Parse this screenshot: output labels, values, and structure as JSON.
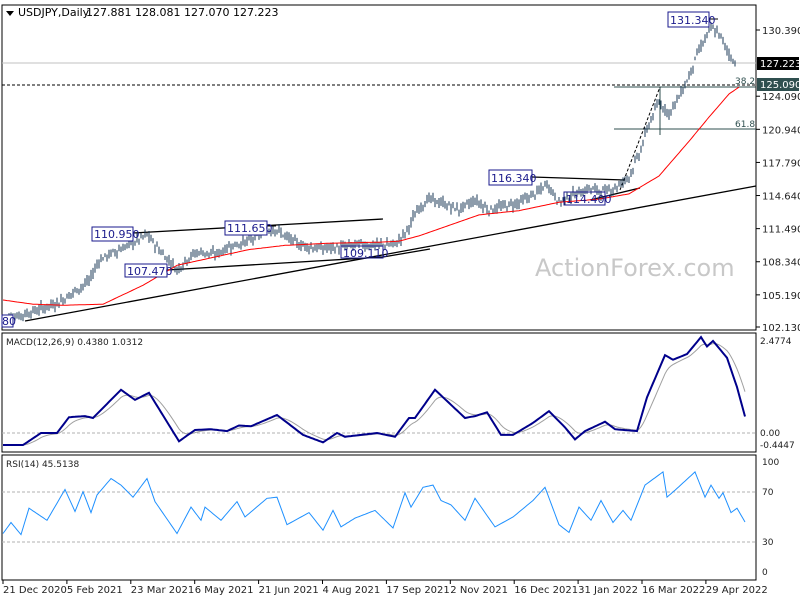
{
  "header": {
    "arrow_icon": "triangle-down-icon",
    "title": "USDJPY,Daily",
    "ohlc": "127.881 128.081 127.070 127.223"
  },
  "price_axis": [
    "130.390",
    "124.090",
    "120.940",
    "117.790",
    "114.640",
    "111.490",
    "108.340",
    "105.190",
    "102.130"
  ],
  "price_axis_values": [
    130.39,
    124.09,
    120.94,
    117.79,
    114.64,
    111.49,
    108.34,
    105.19,
    102.13
  ],
  "current_price": "127.223",
  "level_price": "125.090",
  "fib": {
    "f382": "38.2",
    "f618": "61.8"
  },
  "annotations": {
    "a131340": "131.340",
    "a116340": "116.340",
    "a114400": "114.400",
    "a110950": "110.950",
    "a111650": "111.650",
    "a107470": "107.470",
    "a109110": "109.110",
    "a_left": "80"
  },
  "watermark": "ActionForex.com",
  "macd": {
    "label": "MACD(12,26,9) 0.4380 1.0312",
    "axis": [
      "2.4774",
      "0.00",
      "-0.4447"
    ]
  },
  "rsi": {
    "label": "RSI(14) 45.5138",
    "axis": [
      "100",
      "70",
      "30",
      "0"
    ]
  },
  "dates": [
    "21 Dec 2020",
    "5 Feb 2021",
    "23 Mar 2021",
    "6 May 2021",
    "21 Jun 2021",
    "4 Aug 2021",
    "17 Sep 2021",
    "2 Nov 2021",
    "16 Dec 2021",
    "31 Jan 2022",
    "16 Mar 2022",
    "29 Apr 2022"
  ],
  "colors": {
    "bars": "#1b3a57",
    "ma": "#ff0000",
    "macd": "#00008b",
    "signal": "#a0a0a0",
    "rsi": "#1e90ff",
    "label": "#1a1a8c"
  },
  "chart_data": {
    "type": "line",
    "title": "USDJPY,Daily",
    "price_close": [
      [
        0,
        103.0
      ],
      [
        8,
        103.2
      ],
      [
        18,
        103.8
      ],
      [
        28,
        104.5
      ],
      [
        32,
        105.0
      ],
      [
        43,
        106.5
      ],
      [
        48,
        108.5
      ],
      [
        53,
        109.0
      ],
      [
        58,
        109.5
      ],
      [
        64,
        110.0
      ],
      [
        72,
        110.9
      ],
      [
        78,
        109.5
      ],
      [
        87,
        107.6
      ],
      [
        93,
        108.8
      ],
      [
        98,
        109.3
      ],
      [
        106,
        109.0
      ],
      [
        113,
        109.8
      ],
      [
        123,
        110.3
      ],
      [
        131,
        111.3
      ],
      [
        136,
        111.5
      ],
      [
        143,
        110.5
      ],
      [
        148,
        110.0
      ],
      [
        158,
        109.6
      ],
      [
        168,
        109.7
      ],
      [
        178,
        110.0
      ],
      [
        188,
        109.9
      ],
      [
        196,
        110.0
      ],
      [
        201,
        111.0
      ],
      [
        208,
        113.5
      ],
      [
        213,
        114.3
      ],
      [
        218,
        114.0
      ],
      [
        228,
        113.3
      ],
      [
        236,
        114.2
      ],
      [
        243,
        113.3
      ],
      [
        248,
        113.5
      ],
      [
        258,
        114.0
      ],
      [
        268,
        115.0
      ],
      [
        272,
        115.8
      ],
      [
        278,
        114.0
      ],
      [
        286,
        114.8
      ],
      [
        293,
        115.3
      ],
      [
        301,
        115.0
      ],
      [
        308,
        115.6
      ],
      [
        313,
        116.5
      ],
      [
        318,
        118.5
      ],
      [
        323,
        121.5
      ],
      [
        328,
        123.5
      ],
      [
        333,
        122.5
      ],
      [
        338,
        124.0
      ],
      [
        343,
        126.0
      ],
      [
        348,
        128.5
      ],
      [
        351,
        129.5
      ],
      [
        354,
        130.6
      ],
      [
        358,
        130.0
      ],
      [
        362,
        128.5
      ],
      [
        366,
        127.2
      ]
    ],
    "moving_average": [
      [
        0,
        104.7
      ],
      [
        15,
        104.3
      ],
      [
        30,
        104.2
      ],
      [
        50,
        104.3
      ],
      [
        70,
        106.1
      ],
      [
        87,
        108.0
      ],
      [
        123,
        109.5
      ],
      [
        141,
        109.9
      ],
      [
        163,
        110.1
      ],
      [
        188,
        110.2
      ],
      [
        198,
        110.3
      ],
      [
        208,
        110.8
      ],
      [
        223,
        111.8
      ],
      [
        238,
        112.8
      ],
      [
        258,
        113.2
      ],
      [
        278,
        114.0
      ],
      [
        298,
        114.3
      ],
      [
        313,
        114.8
      ],
      [
        328,
        116.5
      ],
      [
        343,
        119.8
      ],
      [
        353,
        122.1
      ],
      [
        363,
        124.3
      ],
      [
        368,
        124.95
      ]
    ],
    "macd_line": [
      [
        0,
        -0.32
      ],
      [
        10,
        -0.32
      ],
      [
        19,
        0.0
      ],
      [
        27,
        0.0
      ],
      [
        33,
        0.42
      ],
      [
        41,
        0.45
      ],
      [
        45,
        0.4
      ],
      [
        59,
        1.15
      ],
      [
        66,
        0.88
      ],
      [
        73,
        1.07
      ],
      [
        88,
        -0.22
      ],
      [
        96,
        0.08
      ],
      [
        104,
        0.1
      ],
      [
        112,
        0.05
      ],
      [
        118,
        0.2
      ],
      [
        124,
        0.18
      ],
      [
        137,
        0.48
      ],
      [
        150,
        -0.05
      ],
      [
        160,
        -0.25
      ],
      [
        167,
        0.0
      ],
      [
        171,
        -0.1
      ],
      [
        187,
        0.0
      ],
      [
        196,
        -0.1
      ],
      [
        203,
        0.4
      ],
      [
        206,
        0.4
      ],
      [
        216,
        1.15
      ],
      [
        224,
        0.75
      ],
      [
        231,
        0.4
      ],
      [
        236,
        0.45
      ],
      [
        242,
        0.55
      ],
      [
        249,
        -0.05
      ],
      [
        255,
        -0.05
      ],
      [
        265,
        0.27
      ],
      [
        273,
        0.58
      ],
      [
        281,
        0.15
      ],
      [
        286,
        -0.17
      ],
      [
        291,
        0.05
      ],
      [
        301,
        0.3
      ],
      [
        306,
        0.1
      ],
      [
        317,
        0.05
      ],
      [
        322,
        0.95
      ],
      [
        331,
        2.07
      ],
      [
        335,
        1.95
      ],
      [
        342,
        2.1
      ],
      [
        349,
        2.55
      ],
      [
        352,
        2.3
      ],
      [
        355,
        2.45
      ],
      [
        362,
        2.0
      ],
      [
        367,
        1.22
      ],
      [
        371,
        0.44
      ]
    ],
    "rsi": [
      [
        0,
        35
      ],
      [
        4,
        45
      ],
      [
        9,
        34
      ],
      [
        13,
        58
      ],
      [
        22,
        47
      ],
      [
        31,
        75
      ],
      [
        36,
        55
      ],
      [
        40,
        73
      ],
      [
        44,
        54
      ],
      [
        47,
        70
      ],
      [
        54,
        85
      ],
      [
        59,
        79
      ],
      [
        65,
        68
      ],
      [
        72,
        85
      ],
      [
        76,
        64
      ],
      [
        87,
        35
      ],
      [
        94,
        59
      ],
      [
        99,
        47
      ],
      [
        101,
        59
      ],
      [
        109,
        47
      ],
      [
        117,
        64
      ],
      [
        121,
        50
      ],
      [
        132,
        67
      ],
      [
        137,
        68
      ],
      [
        142,
        43
      ],
      [
        153,
        54
      ],
      [
        160,
        38
      ],
      [
        165,
        56
      ],
      [
        169,
        41
      ],
      [
        176,
        49
      ],
      [
        186,
        56
      ],
      [
        195,
        40
      ],
      [
        201,
        72
      ],
      [
        204,
        59
      ],
      [
        210,
        77
      ],
      [
        215,
        79
      ],
      [
        219,
        65
      ],
      [
        224,
        61
      ],
      [
        231,
        47
      ],
      [
        236,
        67
      ],
      [
        246,
        41
      ],
      [
        255,
        50
      ],
      [
        265,
        65
      ],
      [
        271,
        77
      ],
      [
        278,
        43
      ],
      [
        283,
        36
      ],
      [
        288,
        59
      ],
      [
        294,
        47
      ],
      [
        299,
        65
      ],
      [
        305,
        45
      ],
      [
        310,
        56
      ],
      [
        314,
        47
      ],
      [
        321,
        79
      ],
      [
        330,
        91
      ],
      [
        332,
        68
      ],
      [
        337,
        76
      ],
      [
        346,
        91
      ],
      [
        351,
        68
      ],
      [
        354,
        79
      ],
      [
        358,
        67
      ],
      [
        360,
        72
      ],
      [
        364,
        54
      ],
      [
        367,
        58
      ],
      [
        371,
        45.5
      ]
    ],
    "ylim_price": [
      102.13,
      130.39
    ],
    "ylim_macd": [
      -0.4447,
      2.4774
    ],
    "ylim_rsi": [
      0,
      100
    ],
    "rsi_levels": [
      30,
      70
    ]
  }
}
